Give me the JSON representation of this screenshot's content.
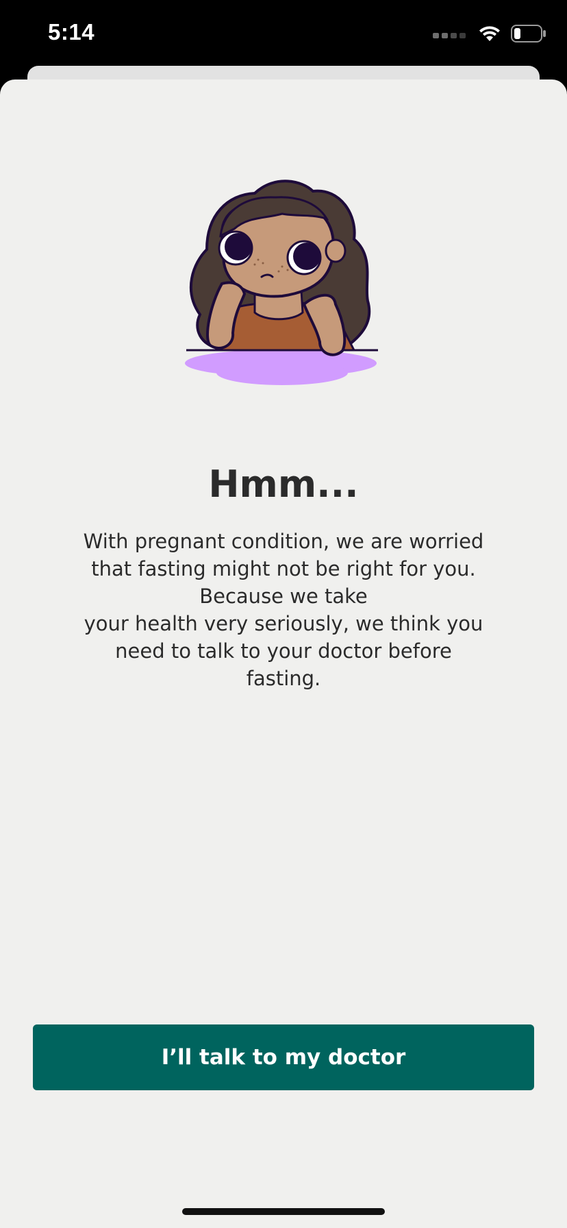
{
  "status_bar": {
    "time": "5:14",
    "signal_icon": "cellular-signal-icon",
    "wifi_icon": "wifi-icon",
    "battery_icon": "battery-icon",
    "battery_level": 0.25
  },
  "illustration": {
    "icon": "thinking-woman-illustration"
  },
  "dialog": {
    "title": "Hmm...",
    "message_lines": [
      "With pregnant condition, we are worried",
      "that fasting might not be right for you.",
      "Because we take",
      "your health very seriously, we think you",
      "need to talk to your doctor before",
      "fasting."
    ],
    "button_label": "I’ll talk to my doctor"
  },
  "colors": {
    "background": "#f0f0ee",
    "button": "#00645e",
    "button_text": "#ffffff",
    "text": "#2b2b2b",
    "accent_purple": "#d19cff"
  }
}
